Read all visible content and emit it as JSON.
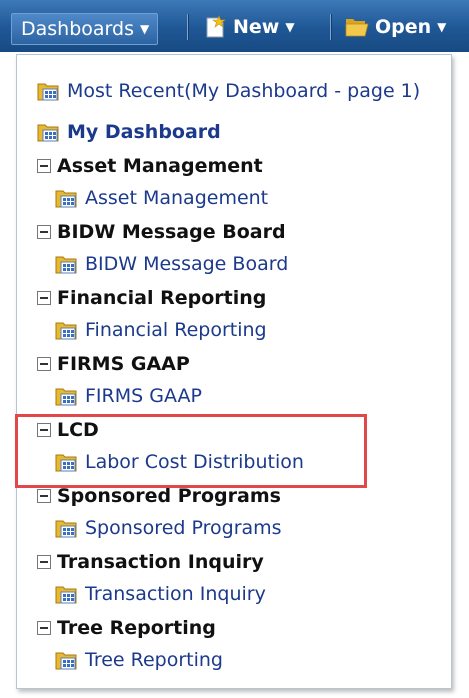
{
  "toolbar": {
    "dashboards_label": "Dashboards",
    "new_label": "New",
    "open_label": "Open"
  },
  "menu": {
    "most_recent": "Most Recent(My Dashboard - page 1)",
    "my_dashboard": "My Dashboard",
    "groups": [
      {
        "name": "Asset Management",
        "item": "Asset Management"
      },
      {
        "name": "BIDW Message Board",
        "item": "BIDW Message Board"
      },
      {
        "name": "Financial Reporting",
        "item": "Financial Reporting"
      },
      {
        "name": "FIRMS GAAP",
        "item": "FIRMS GAAP"
      },
      {
        "name": "LCD",
        "item": "Labor Cost Distribution"
      },
      {
        "name": "Sponsored Programs",
        "item": "Sponsored Programs"
      },
      {
        "name": "Transaction Inquiry",
        "item": "Transaction Inquiry"
      },
      {
        "name": "Tree Reporting",
        "item": "Tree Reporting"
      }
    ]
  },
  "highlight_color": "#e0484a",
  "link_color": "#1c3a8c"
}
